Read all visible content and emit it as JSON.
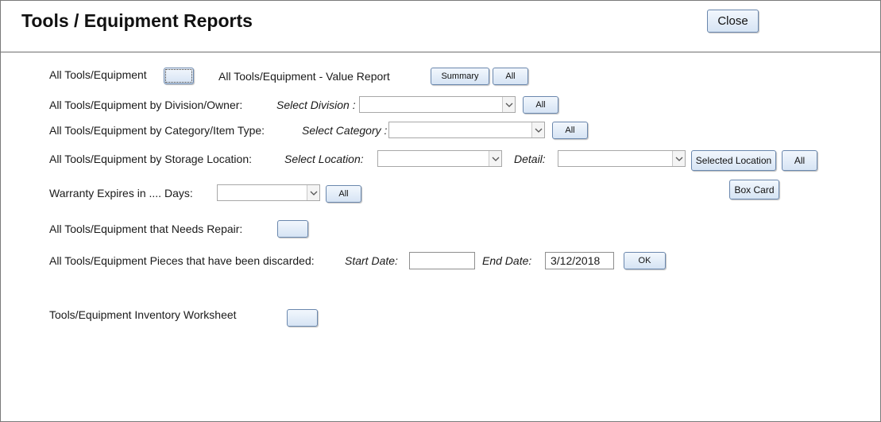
{
  "header": {
    "title": "Tools / Equipment Reports",
    "close_label": "Close"
  },
  "rows": {
    "all_tools": {
      "label": "All Tools/Equipment",
      "button_label": ""
    },
    "value_report": {
      "label": "All Tools/Equipment - Value Report",
      "summary_label": "Summary",
      "all_label": "All"
    },
    "division": {
      "label": "All Tools/Equipment by Division/Owner:",
      "select_label": "Select Division :",
      "select_value": "",
      "all_label": "All"
    },
    "category": {
      "label": "All Tools/Equipment by Category/Item Type:",
      "select_label": "Select Category :",
      "select_value": "",
      "all_label": "All"
    },
    "location": {
      "label": "All Tools/Equipment by Storage Location:",
      "select_label": "Select Location:",
      "select_value": "",
      "detail_label": "Detail:",
      "detail_value": "",
      "selected_location_label": "Selected Location",
      "all_label": "All",
      "box_card_label": "Box Card"
    },
    "warranty": {
      "label": "Warranty Expires in .... Days:",
      "select_value": "",
      "all_label": "All"
    },
    "repair": {
      "label": "All Tools/Equipment that Needs Repair:",
      "button_label": ""
    },
    "discarded": {
      "label": "All Tools/Equipment Pieces that have been discarded:",
      "start_label": "Start Date:",
      "start_value": "",
      "end_label": "End Date:",
      "end_value": "3/12/2018",
      "ok_label": "OK"
    },
    "worksheet": {
      "label": "Tools/Equipment Inventory Worksheet",
      "button_label": ""
    }
  },
  "colors": {
    "button_top": "#f2f7fd",
    "button_bottom": "#d6e4f4",
    "button_border": "#6a87ad",
    "divider": "#6f6f6f"
  },
  "icons": {
    "dropdown": "chevron-down-icon"
  }
}
